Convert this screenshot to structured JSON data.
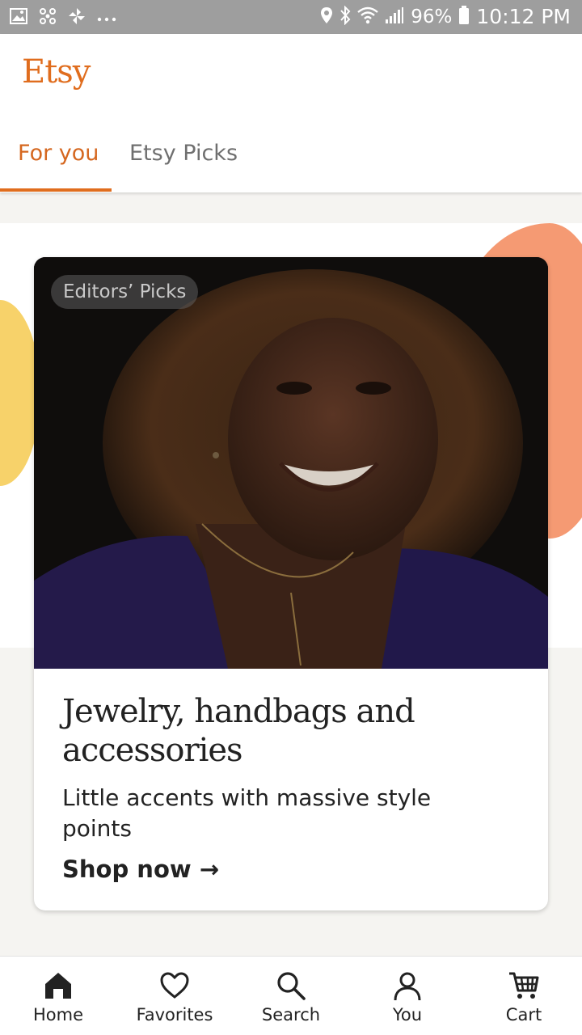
{
  "status_bar": {
    "battery": "96%",
    "time": "10:12 PM"
  },
  "app": {
    "logo": "Etsy"
  },
  "tabs": [
    {
      "label": "For you",
      "active": true
    },
    {
      "label": "Etsy Picks",
      "active": false
    }
  ],
  "card": {
    "badge": "Editors’ Picks",
    "title": "Jewelry, handbags and accessories",
    "subtitle": "Little accents with massive style points",
    "cta": "Shop now →"
  },
  "bottom_nav": [
    {
      "label": "Home",
      "icon": "home-icon"
    },
    {
      "label": "Favorites",
      "icon": "heart-icon"
    },
    {
      "label": "Search",
      "icon": "search-icon"
    },
    {
      "label": "You",
      "icon": "user-icon"
    },
    {
      "label": "Cart",
      "icon": "cart-icon"
    }
  ],
  "colors": {
    "accent": "#e06d1e",
    "status_bar": "#9e9e9e"
  }
}
